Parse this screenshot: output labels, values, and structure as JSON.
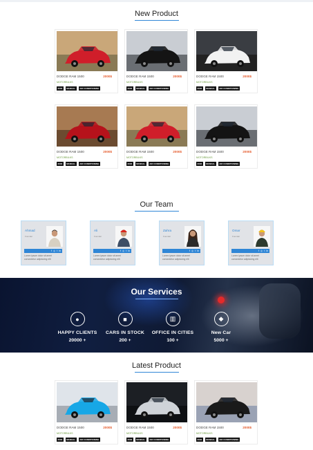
{
  "new_product": {
    "title": "New Product"
  },
  "our_team": {
    "title": "Our Team"
  },
  "our_services": {
    "title": "Our Services"
  },
  "latest_product": {
    "title": "Latest Product"
  },
  "product": {
    "name": "DODGE RAM 1500",
    "price": "2000$",
    "subtitle": "MOTORBILKS",
    "tags": [
      "2002",
      "MANUAL",
      "AIR CONDITIONING"
    ]
  },
  "new_products": [
    {
      "image": "red-suv",
      "price": "2000$"
    },
    {
      "image": "black-car-road",
      "price": "2000$"
    },
    {
      "image": "white-sports-car",
      "price": "2000$"
    },
    {
      "image": "red-car-front",
      "price": "2000$"
    },
    {
      "image": "red-suv",
      "price": "2000$"
    },
    {
      "image": "black-car-road",
      "price": "2000$"
    }
  ],
  "latest_products": [
    {
      "image": "blue-sports-car",
      "price": "2000$"
    },
    {
      "image": "silver-car-dark",
      "price": "2000$"
    },
    {
      "image": "black-car-sunset",
      "price": "2000$"
    }
  ],
  "team": [
    {
      "name": "Ahmad",
      "role": "Founder",
      "photo": "man-casual",
      "desc": "Lorem ipsum dolor sit amet consectetur adipisicing elit"
    },
    {
      "name": "Ali",
      "role": "Founder",
      "photo": "engineer-red-helmet",
      "desc": "Lorem ipsum dolor sit amet consectetur adipisicing elit"
    },
    {
      "name": "Zahra",
      "role": "Founder",
      "photo": "woman-long-hair",
      "desc": "Lorem ipsum dolor sit amet consectetur adipisicing elit"
    },
    {
      "name": "Omar",
      "role": "Founder",
      "photo": "engineer-yellow-helmet",
      "desc": "Lorem ipsum dolor sit amet consectetur adipisicing elit"
    }
  ],
  "social_icons": [
    "f",
    "◎",
    "t",
    "in"
  ],
  "stats": [
    {
      "icon": "user-icon",
      "label": "HAPPY CLIENTS",
      "value": "20000 +"
    },
    {
      "icon": "truck-icon",
      "label": "CARS IN STOCK",
      "value": "200 +"
    },
    {
      "icon": "building-icon",
      "label": "OFFICE IN CITIES",
      "value": "100 +"
    },
    {
      "icon": "car-icon",
      "label": "New Car",
      "value": "5000 +"
    }
  ]
}
